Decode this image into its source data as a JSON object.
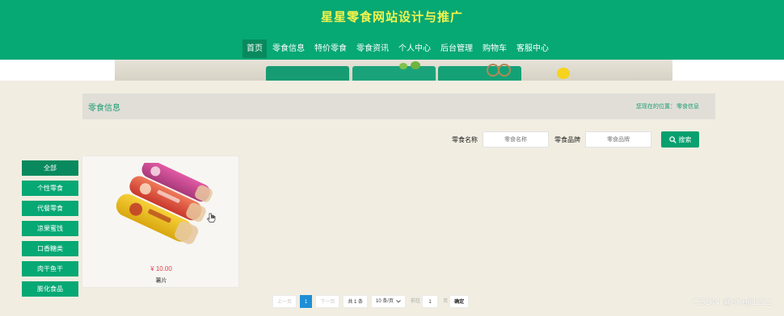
{
  "header": {
    "site_title": "星星零食网站设计与推广",
    "nav": [
      {
        "label": "首页",
        "active": true
      },
      {
        "label": "零食信息"
      },
      {
        "label": "特价零食"
      },
      {
        "label": "零食资讯"
      },
      {
        "label": "个人中心"
      },
      {
        "label": "后台管理"
      },
      {
        "label": "购物车"
      },
      {
        "label": "客服中心"
      }
    ]
  },
  "breadcrumb": {
    "title": "零食信息",
    "location_prefix": "您现在的位置：",
    "location_current": "零食信息"
  },
  "search": {
    "name_label": "零食名称",
    "name_placeholder": "零食名称",
    "brand_label": "零食品牌",
    "brand_placeholder": "零食品牌",
    "button_label": "搜索"
  },
  "categories": [
    {
      "label": "全部",
      "active": true
    },
    {
      "label": "个性零食"
    },
    {
      "label": "代餐零食"
    },
    {
      "label": "凉果蜜饯"
    },
    {
      "label": "口香糖类"
    },
    {
      "label": "肉干鱼干"
    },
    {
      "label": "膨化食品"
    }
  ],
  "products": [
    {
      "price": "¥ 10.00",
      "name": "薯片"
    }
  ],
  "pagination": {
    "prev": "上一页",
    "current_page": "1",
    "next": "下一页",
    "total": "共 1 条",
    "page_size": "10 条/页",
    "goto_prefix": "前往",
    "goto_value": "1",
    "goto_suffix": "页",
    "confirm": "确定"
  },
  "watermark": "CSDN @sheji1211",
  "colors": {
    "brand_green": "#06a874",
    "title_yellow": "#f3f34c",
    "price_red": "#e0414d",
    "page_blue": "#1e8fd6"
  }
}
